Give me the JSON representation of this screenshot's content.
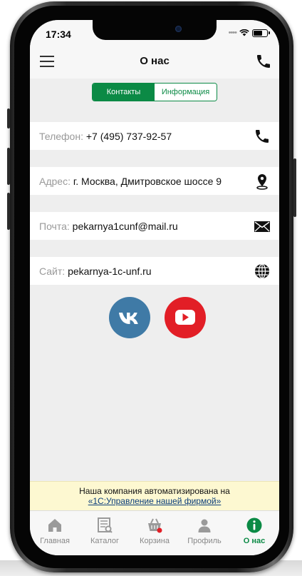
{
  "status_bar": {
    "time": "17:34"
  },
  "nav": {
    "title": "О нас"
  },
  "segments": [
    {
      "label": "Контакты",
      "active": true
    },
    {
      "label": "Информация",
      "active": false
    }
  ],
  "contacts": [
    {
      "label": "Телефон:",
      "value": "+7 (495) 737-92-57",
      "icon": "phone-icon"
    },
    {
      "label": "Адрес:",
      "value": "г. Москва, Дмитровское шоссе 9",
      "icon": "location-pin-icon"
    },
    {
      "label": "Почта:",
      "value": "pekarnya1cunf@mail.ru",
      "icon": "mail-icon"
    },
    {
      "label": "Сайт:",
      "value": "pekarnya-1c-unf.ru",
      "icon": "globe-icon"
    }
  ],
  "social": [
    {
      "name": "vk-icon",
      "color": "#3f7aa6"
    },
    {
      "name": "youtube-icon",
      "color": "#e21e26"
    }
  ],
  "banner": {
    "text": "Наша компания автоматизирована на",
    "link": "«1С:Управление нашей фирмой»"
  },
  "tabs": [
    {
      "label": "Главная",
      "icon": "home-icon",
      "active": false
    },
    {
      "label": "Каталог",
      "icon": "catalog-icon",
      "active": false
    },
    {
      "label": "Корзина",
      "icon": "cart-icon",
      "active": false
    },
    {
      "label": "Профиль",
      "icon": "profile-icon",
      "active": false
    },
    {
      "label": "О нас",
      "icon": "info-icon",
      "active": true
    }
  ],
  "colors": {
    "accent": "#0b8a45",
    "banner_bg": "#fdf8d1",
    "vk": "#3f7aa6",
    "youtube": "#e21e26"
  }
}
